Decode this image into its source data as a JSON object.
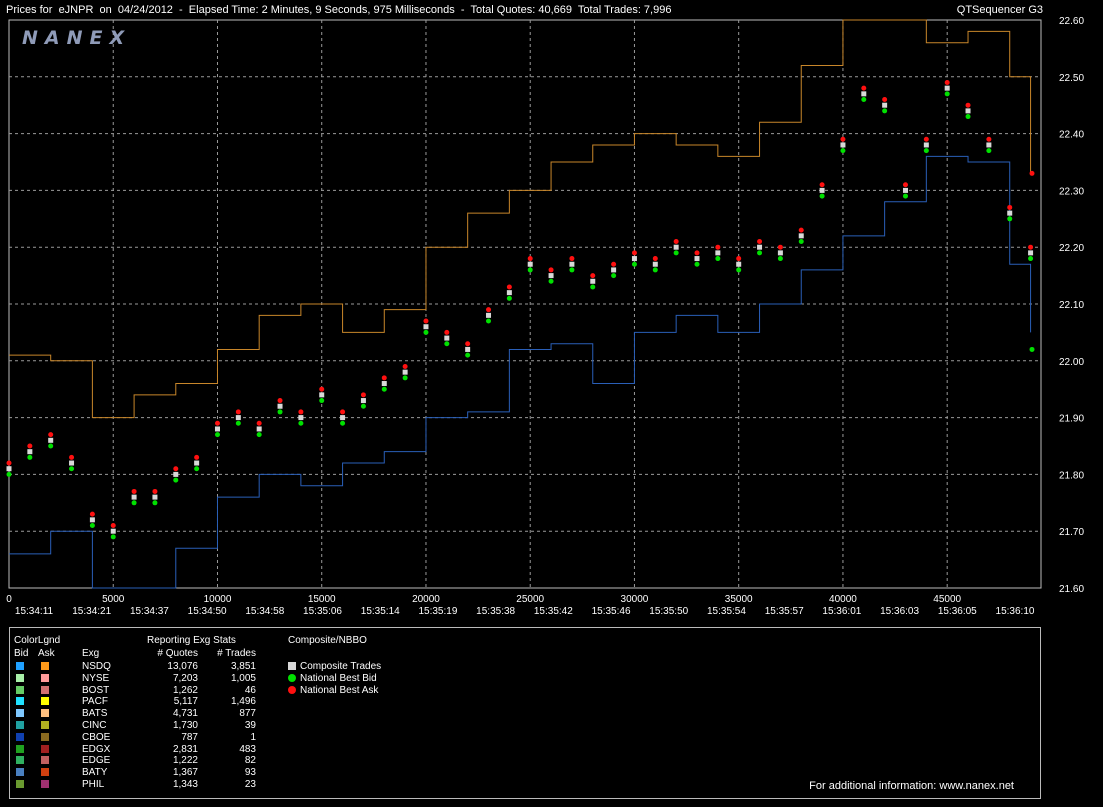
{
  "header": {
    "title": "Prices for  eJNPR  on  04/24/2012  -  Elapsed Time: 2 Minutes, 9 Seconds, 975 Milliseconds  -  Total Quotes: 40,669  Total Trades: 7,996",
    "app_name": "QTSequencer G3",
    "logo_text": "NANEX"
  },
  "colors": {
    "background": "#000000",
    "grid": "#9a9a9a",
    "ask_line": "#c8862a",
    "bid_line": "#2a5fb8",
    "composite_trade": "#d8d8d8",
    "national_best_bid": "#00e000",
    "national_best_ask": "#ff1010"
  },
  "chart_data": {
    "type": "line",
    "title": "",
    "xlabel": "",
    "ylabel": "",
    "xlim": [
      0,
      49500
    ],
    "ylim": [
      21.6,
      22.6
    ],
    "x_ticks": [
      0,
      5000,
      10000,
      15000,
      20000,
      25000,
      30000,
      35000,
      40000,
      45000
    ],
    "y_ticks": [
      "21.60",
      "21.70",
      "21.80",
      "21.90",
      "22.00",
      "22.10",
      "22.20",
      "22.30",
      "22.40",
      "22.50",
      "22.60"
    ],
    "time_labels": [
      "15:34:11",
      "15:34:21",
      "15:34:37",
      "15:34:50",
      "15:34:58",
      "15:35:06",
      "15:35:14",
      "15:35:19",
      "15:35:38",
      "15:35:42",
      "15:35:46",
      "15:35:50",
      "15:35:54",
      "15:35:57",
      "15:36:01",
      "15:36:03",
      "15:36:05",
      "15:36:10"
    ],
    "grid": true,
    "series": [
      {
        "name": "Composite Trades",
        "x": [
          0,
          1000,
          2000,
          3000,
          4000,
          5000,
          6000,
          7000,
          8000,
          9000,
          10000,
          11000,
          12000,
          13000,
          14000,
          15000,
          16000,
          17000,
          18000,
          19000,
          20000,
          21000,
          22000,
          23000,
          24000,
          25000,
          26000,
          27000,
          28000,
          29000,
          30000,
          31000,
          32000,
          33000,
          34000,
          35000,
          36000,
          37000,
          38000,
          39000,
          40000,
          41000,
          42000,
          43000,
          44000,
          45000,
          46000,
          47000,
          48000,
          49000
        ],
        "values": [
          21.81,
          21.84,
          21.86,
          21.82,
          21.72,
          21.7,
          21.76,
          21.76,
          21.8,
          21.82,
          21.88,
          21.9,
          21.88,
          21.92,
          21.9,
          21.94,
          21.9,
          21.93,
          21.96,
          21.98,
          22.06,
          22.04,
          22.02,
          22.08,
          22.12,
          22.17,
          22.15,
          22.17,
          22.14,
          22.16,
          22.18,
          22.17,
          22.2,
          22.18,
          22.19,
          22.17,
          22.2,
          22.19,
          22.22,
          22.3,
          22.38,
          22.47,
          22.45,
          22.3,
          22.38,
          22.48,
          22.44,
          22.38,
          22.26,
          22.19
        ]
      },
      {
        "name": "National Best Bid",
        "x": [
          0,
          1000,
          2000,
          3000,
          4000,
          5000,
          6000,
          7000,
          8000,
          9000,
          10000,
          11000,
          12000,
          13000,
          14000,
          15000,
          16000,
          17000,
          18000,
          19000,
          20000,
          21000,
          22000,
          23000,
          24000,
          25000,
          26000,
          27000,
          28000,
          29000,
          30000,
          31000,
          32000,
          33000,
          34000,
          35000,
          36000,
          37000,
          38000,
          39000,
          40000,
          41000,
          42000,
          43000,
          44000,
          45000,
          46000,
          47000,
          48000,
          49000
        ],
        "values": [
          21.8,
          21.83,
          21.85,
          21.81,
          21.71,
          21.69,
          21.75,
          21.75,
          21.79,
          21.81,
          21.87,
          21.89,
          21.87,
          21.91,
          21.89,
          21.93,
          21.89,
          21.92,
          21.95,
          21.97,
          22.05,
          22.03,
          22.01,
          22.07,
          22.11,
          22.16,
          22.14,
          22.16,
          22.13,
          22.15,
          22.17,
          22.16,
          22.19,
          22.17,
          22.18,
          22.16,
          22.19,
          22.18,
          22.21,
          22.29,
          22.37,
          22.46,
          22.44,
          22.29,
          22.37,
          22.47,
          22.43,
          22.37,
          22.25,
          22.18
        ]
      },
      {
        "name": "National Best Ask",
        "x": [
          0,
          1000,
          2000,
          3000,
          4000,
          5000,
          6000,
          7000,
          8000,
          9000,
          10000,
          11000,
          12000,
          13000,
          14000,
          15000,
          16000,
          17000,
          18000,
          19000,
          20000,
          21000,
          22000,
          23000,
          24000,
          25000,
          26000,
          27000,
          28000,
          29000,
          30000,
          31000,
          32000,
          33000,
          34000,
          35000,
          36000,
          37000,
          38000,
          39000,
          40000,
          41000,
          42000,
          43000,
          44000,
          45000,
          46000,
          47000,
          48000,
          49000
        ],
        "values": [
          21.82,
          21.85,
          21.87,
          21.83,
          21.73,
          21.71,
          21.77,
          21.77,
          21.81,
          21.83,
          21.89,
          21.91,
          21.89,
          21.93,
          21.91,
          21.95,
          21.91,
          21.94,
          21.97,
          21.99,
          22.07,
          22.05,
          22.03,
          22.09,
          22.13,
          22.18,
          22.16,
          22.18,
          22.15,
          22.17,
          22.19,
          22.18,
          22.21,
          22.19,
          22.2,
          22.18,
          22.21,
          22.2,
          22.23,
          22.31,
          22.39,
          22.48,
          22.46,
          22.31,
          22.39,
          22.49,
          22.45,
          22.39,
          22.27,
          22.2
        ]
      },
      {
        "x": [
          0,
          2000,
          4000,
          6000,
          8000,
          10000,
          12000,
          14000,
          16000,
          18000,
          20000,
          22000,
          24000,
          26000,
          28000,
          30000,
          32000,
          34000,
          36000,
          38000,
          40000,
          42000,
          44000,
          46000,
          48000,
          49000
        ],
        "values": [
          22.01,
          22.0,
          21.9,
          21.94,
          21.96,
          22.02,
          22.08,
          22.1,
          22.05,
          22.09,
          22.2,
          22.26,
          22.3,
          22.35,
          22.38,
          22.4,
          22.38,
          22.36,
          22.42,
          22.52,
          22.6,
          22.6,
          22.56,
          22.58,
          22.5,
          22.33
        ]
      },
      {
        "x": [
          0,
          2000,
          4000,
          6000,
          8000,
          10000,
          12000,
          14000,
          16000,
          18000,
          20000,
          22000,
          24000,
          26000,
          28000,
          30000,
          32000,
          34000,
          36000,
          38000,
          40000,
          42000,
          44000,
          46000,
          48000,
          49000
        ],
        "values": [
          21.66,
          21.7,
          21.6,
          21.6,
          21.67,
          21.76,
          21.8,
          21.78,
          21.82,
          21.84,
          21.9,
          21.91,
          22.02,
          22.03,
          21.96,
          22.05,
          22.08,
          22.05,
          22.1,
          22.16,
          22.22,
          22.28,
          22.36,
          22.35,
          22.17,
          22.05
        ]
      }
    ]
  },
  "markers": {
    "ask_price": 22.33,
    "bid_price": 22.02
  },
  "legend": {
    "headers": {
      "color_legend": "ColorLgnd",
      "bid": "Bid",
      "ask": "Ask",
      "exchange": "Exg",
      "reporting": "Reporting Exg Stats",
      "quotes": "# Quotes",
      "trades": "# Trades",
      "composite": "Composite/NBBO"
    },
    "exchanges": [
      {
        "name": "NSDQ",
        "quotes": "13,076",
        "trades": "3,851",
        "bid_color": "#1fa0ff",
        "ask_color": "#ff9a1a"
      },
      {
        "name": "NYSE",
        "quotes": "7,203",
        "trades": "1,005",
        "bid_color": "#a8f0a8",
        "ask_color": "#ff9a9a"
      },
      {
        "name": "BOST",
        "quotes": "1,262",
        "trades": "46",
        "bid_color": "#66cc66",
        "ask_color": "#d07070"
      },
      {
        "name": "PACF",
        "quotes": "5,117",
        "trades": "1,496",
        "bid_color": "#1fe0ff",
        "ask_color": "#ffff00"
      },
      {
        "name": "BATS",
        "quotes": "4,731",
        "trades": "877",
        "bid_color": "#7fc8ff",
        "ask_color": "#ffc080"
      },
      {
        "name": "CINC",
        "quotes": "1,730",
        "trades": "39",
        "bid_color": "#20a0a0",
        "ask_color": "#b0b020"
      },
      {
        "name": "CBOE",
        "quotes": "787",
        "trades": "1",
        "bid_color": "#1040b0",
        "ask_color": "#8a6a20"
      },
      {
        "name": "EDGX",
        "quotes": "2,831",
        "trades": "483",
        "bid_color": "#20a020",
        "ask_color": "#a02020"
      },
      {
        "name": "EDGE",
        "quotes": "1,222",
        "trades": "82",
        "bid_color": "#30b060",
        "ask_color": "#c06060"
      },
      {
        "name": "BATY",
        "quotes": "1,367",
        "trades": "93",
        "bid_color": "#4a80c0",
        "ask_color": "#d04010"
      },
      {
        "name": "PHIL",
        "quotes": "1,343",
        "trades": "23",
        "bid_color": "#6a9a30",
        "ask_color": "#a03070"
      }
    ],
    "composite_items": [
      {
        "label": "Composite Trades",
        "color": "#d8d8d8",
        "shape": "square"
      },
      {
        "label": "National Best Bid",
        "color": "#00e000",
        "shape": "dot"
      },
      {
        "label": "National Best Ask",
        "color": "#ff1010",
        "shape": "dot"
      }
    ]
  },
  "footer": {
    "note": "For additional information: www.nanex.net"
  }
}
